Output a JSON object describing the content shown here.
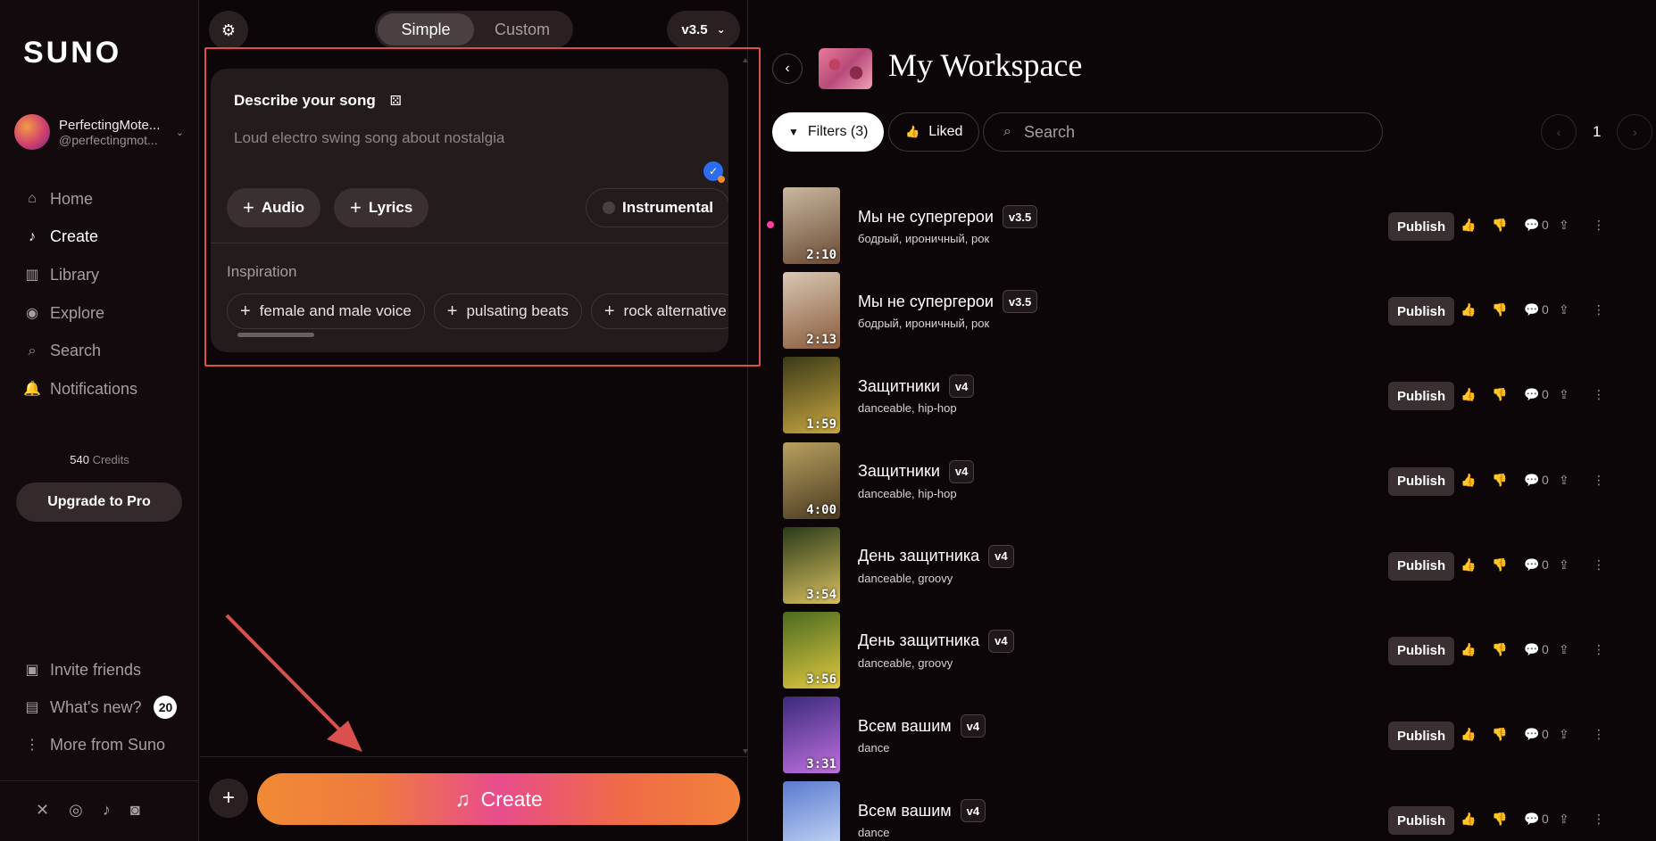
{
  "sidebar": {
    "logo": "SUNO",
    "user": {
      "name": "PerfectingMote...",
      "handle": "@perfectingmot..."
    },
    "nav": [
      {
        "label": "Home",
        "icon": "home-icon",
        "glyph": "⌂",
        "active": false
      },
      {
        "label": "Create",
        "icon": "create-music-icon",
        "glyph": "♪",
        "active": true
      },
      {
        "label": "Library",
        "icon": "library-icon",
        "glyph": "▥",
        "active": false
      },
      {
        "label": "Explore",
        "icon": "explore-icon",
        "glyph": "◉",
        "active": false
      },
      {
        "label": "Search",
        "icon": "search-icon",
        "glyph": "⌕",
        "active": false
      },
      {
        "label": "Notifications",
        "icon": "bell-icon",
        "glyph": "🔔",
        "active": false
      }
    ],
    "credits_value": "540",
    "credits_label": "Credits",
    "upgrade_label": "Upgrade to Pro",
    "bottom_links": [
      {
        "label": "Invite friends",
        "glyph": "▣"
      },
      {
        "label": "What's new?",
        "glyph": "▤",
        "badge": "20"
      },
      {
        "label": "More from Suno",
        "glyph": "⋮"
      }
    ]
  },
  "create_panel": {
    "mode_simple": "Simple",
    "mode_custom": "Custom",
    "version": "v3.5",
    "describe_label": "Describe your song",
    "describe_placeholder": "Loud electro swing song about nostalgia",
    "audio_label": "Audio",
    "lyrics_label": "Lyrics",
    "instrumental_label": "Instrumental",
    "inspiration_label": "Inspiration",
    "inspiration_chips": [
      "female and male voice",
      "pulsating beats",
      "rock alternative"
    ],
    "create_label": "Create"
  },
  "workspace": {
    "title": "My Workspace",
    "filters_label": "Filters (3)",
    "liked_label": "Liked",
    "search_placeholder": "Search",
    "page_number": "1",
    "publish_label": "Publish",
    "songs": [
      {
        "title": "Мы не супергерои",
        "version": "v3.5",
        "tags": "бодрый, ироничный, рок",
        "duration": "2:10",
        "comments": "0",
        "is_new": true,
        "cover_colors": [
          "#c9b8a0",
          "#6a4a34"
        ]
      },
      {
        "title": "Мы не супергерои",
        "version": "v3.5",
        "tags": "бодрый, ироничный, рок",
        "duration": "2:13",
        "comments": "0",
        "is_new": false,
        "cover_colors": [
          "#d8c8b4",
          "#8a5a3a"
        ]
      },
      {
        "title": "Защитники",
        "version": "v4",
        "tags": "danceable, hip-hop",
        "duration": "1:59",
        "comments": "0",
        "is_new": false,
        "cover_colors": [
          "#3a3a18",
          "#c8a640"
        ]
      },
      {
        "title": "Защитники",
        "version": "v4",
        "tags": "danceable, hip-hop",
        "duration": "4:00",
        "comments": "0",
        "is_new": false,
        "cover_colors": [
          "#b8a060",
          "#4a3a20"
        ]
      },
      {
        "title": "День защитника",
        "version": "v4",
        "tags": "danceable, groovy",
        "duration": "3:54",
        "comments": "0",
        "is_new": false,
        "cover_colors": [
          "#2a3a18",
          "#d8c060"
        ]
      },
      {
        "title": "День защитника",
        "version": "v4",
        "tags": "danceable, groovy",
        "duration": "3:56",
        "comments": "0",
        "is_new": false,
        "cover_colors": [
          "#4a6a20",
          "#e0c840"
        ]
      },
      {
        "title": "Всем вашим",
        "version": "v4",
        "tags": "dance",
        "duration": "3:31",
        "comments": "0",
        "is_new": false,
        "cover_colors": [
          "#3a2a7a",
          "#c070e0"
        ]
      },
      {
        "title": "Всем вашим",
        "version": "v4",
        "tags": "dance",
        "duration": "",
        "comments": "0",
        "is_new": false,
        "cover_colors": [
          "#5a7ad0",
          "#d0e0f8"
        ]
      }
    ]
  },
  "colors": {
    "accent_orange": "#f08a34",
    "accent_pink": "#e84c8c",
    "highlight_red": "#d9504d",
    "new_dot": "#ff3fa0"
  }
}
